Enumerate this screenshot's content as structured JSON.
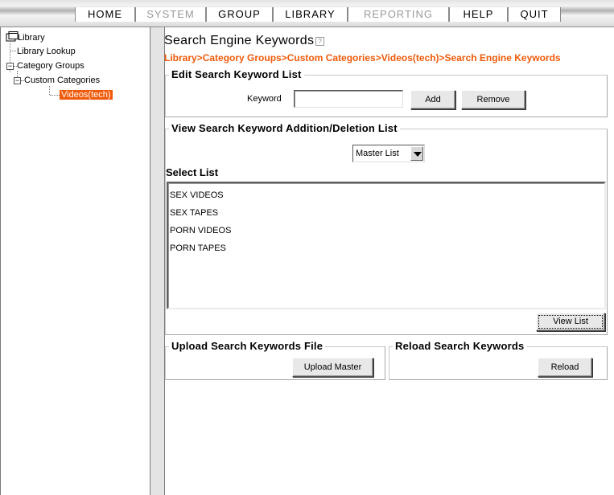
{
  "menu": {
    "items": [
      {
        "label": "HOME",
        "enabled": true
      },
      {
        "label": "SYSTEM",
        "enabled": false
      },
      {
        "label": "GROUP",
        "enabled": true
      },
      {
        "label": "LIBRARY",
        "enabled": true
      },
      {
        "label": "REPORTING",
        "enabled": false
      },
      {
        "label": "HELP",
        "enabled": true
      },
      {
        "label": "QUIT",
        "enabled": true
      }
    ]
  },
  "tree": {
    "root": "Library",
    "library_lookup": "Library Lookup",
    "category_groups": "Category Groups",
    "custom_categories": "Custom Categories",
    "selected": "Videos(tech)"
  },
  "page": {
    "title": "Search Engine Keywords",
    "breadcrumb": "Library>Category Groups>Custom Categories>Videos(tech)>Search Engine Keywords"
  },
  "edit_section": {
    "legend": "Edit Search Keyword List",
    "keyword_label": "Keyword",
    "keyword_value": "",
    "add_label": "Add",
    "remove_label": "Remove"
  },
  "view_section": {
    "legend": "View Search Keyword Addition/Deletion List",
    "list_select_value": "Master List",
    "select_list_label": "Select List",
    "items": [
      "SEX VIDEOS",
      "SEX TAPES",
      "PORN VIDEOS",
      "PORN TAPES"
    ],
    "view_list_label": "View List"
  },
  "upload_section": {
    "legend": "Upload Search Keywords File",
    "button_label": "Upload Master"
  },
  "reload_section": {
    "legend": "Reload Search Keywords",
    "button_label": "Reload"
  },
  "colors": {
    "accent": "#f05a0a",
    "menu_disabled": "#9a9a9a"
  }
}
